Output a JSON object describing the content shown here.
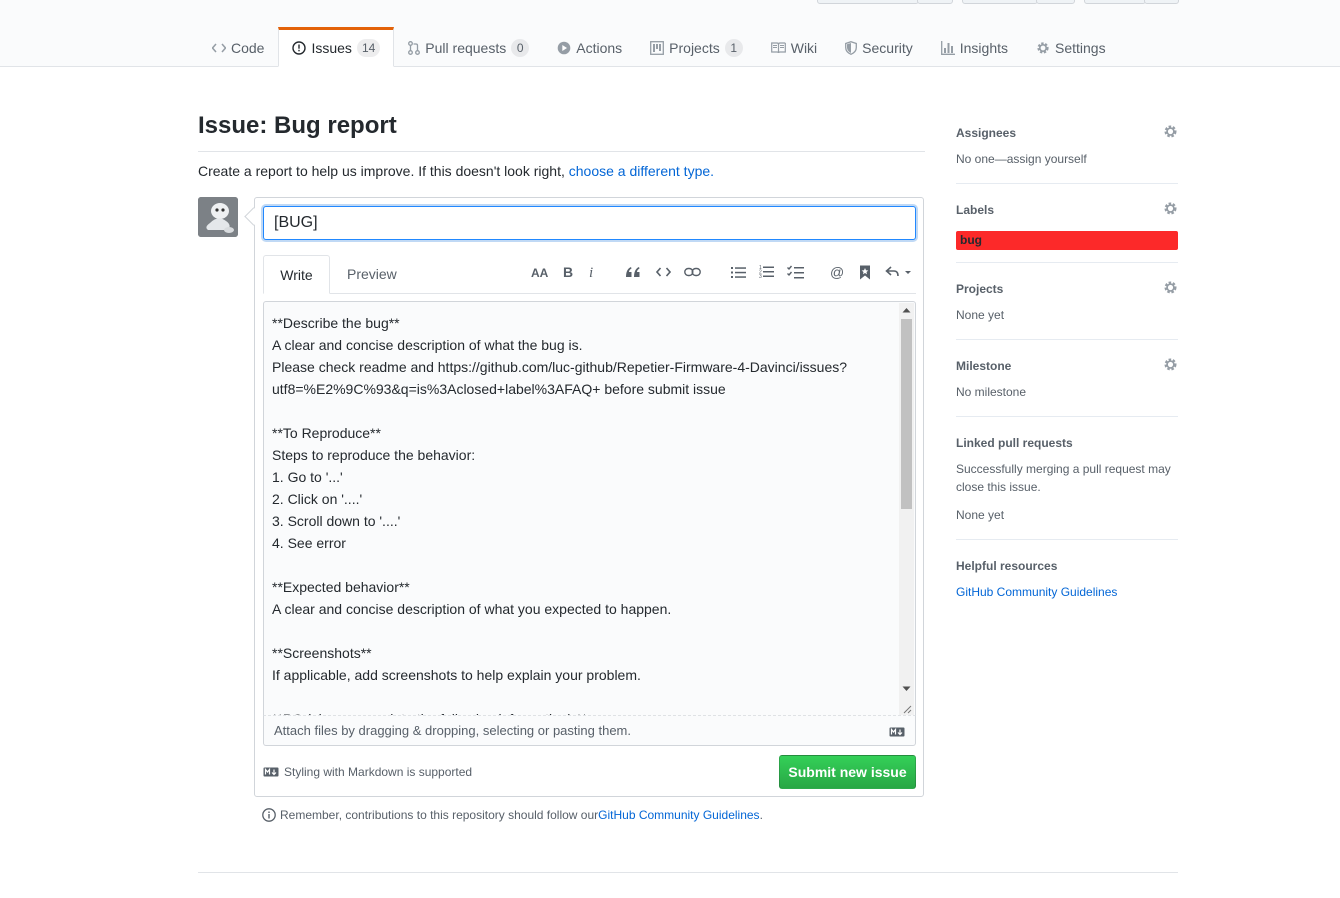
{
  "repo_tabs": [
    {
      "label": "Code",
      "icon": "code-icon"
    },
    {
      "label": "Issues",
      "icon": "issue-opened-icon",
      "count": "14",
      "selected": true
    },
    {
      "label": "Pull requests",
      "icon": "git-pull-request-icon",
      "count": "0"
    },
    {
      "label": "Actions",
      "icon": "play-icon"
    },
    {
      "label": "Projects",
      "icon": "project-icon",
      "count": "1"
    },
    {
      "label": "Wiki",
      "icon": "book-icon"
    },
    {
      "label": "Security",
      "icon": "shield-icon"
    },
    {
      "label": "Insights",
      "icon": "graph-icon"
    },
    {
      "label": "Settings",
      "icon": "gear-icon"
    }
  ],
  "page": {
    "title": "Issue: Bug report",
    "description_prefix": "Create a report to help us improve. If this doesn't look right, ",
    "description_link": "choose a different type.",
    "accent_color": "#e36209"
  },
  "form": {
    "title_value": "[BUG]",
    "write_tab": "Write",
    "preview_tab": "Preview",
    "toolbar": [
      "text-size-icon",
      "bold-icon",
      "italic-icon",
      "quote-icon",
      "code-icon",
      "link-icon",
      "unordered-list-icon",
      "ordered-list-icon",
      "task-list-icon",
      "mention-icon",
      "saved-reply-icon",
      "reply-icon"
    ],
    "body_text": "**Describe the bug**\nA clear and concise description of what the bug is.\nPlease check readme and https://github.com/luc-github/Repetier-Firmware-4-Davinci/issues?utf8=%E2%9C%93&q=is%3Aclosed+label%3AFAQ+ before submit issue\n\n**To Reproduce**\nSteps to reproduce the behavior:\n1. Go to '...'\n2. Click on '....'\n3. Scroll down to '....'\n4. See error\n\n**Expected behavior**\nA clear and concise description of what you expected to happen.\n\n**Screenshots**\nIf applicable, add screenshots to help explain your problem.\n\n**PC (please complete the following information):**",
    "attach_text": "Attach files by dragging & dropping, selecting or pasting them.",
    "markdown_note": "Styling with Markdown is supported",
    "submit_label": "Submit new issue",
    "submit_color": "#28a745",
    "remember_prefix": "Remember, contributions to this repository should follow our ",
    "remember_link": "GitHub Community Guidelines",
    "remember_suffix": "."
  },
  "sidebar": {
    "assignees": {
      "heading": "Assignees",
      "value": "No one—assign yourself"
    },
    "labels": {
      "heading": "Labels",
      "label": "bug",
      "label_color": "#fc2929"
    },
    "projects": {
      "heading": "Projects",
      "value": "None yet"
    },
    "milestone": {
      "heading": "Milestone",
      "value": "No milestone"
    },
    "linked_prs": {
      "heading": "Linked pull requests",
      "note": "Successfully merging a pull request may close this issue.",
      "value": "None yet"
    },
    "helpful": {
      "heading": "Helpful resources",
      "link": "GitHub Community Guidelines"
    }
  }
}
